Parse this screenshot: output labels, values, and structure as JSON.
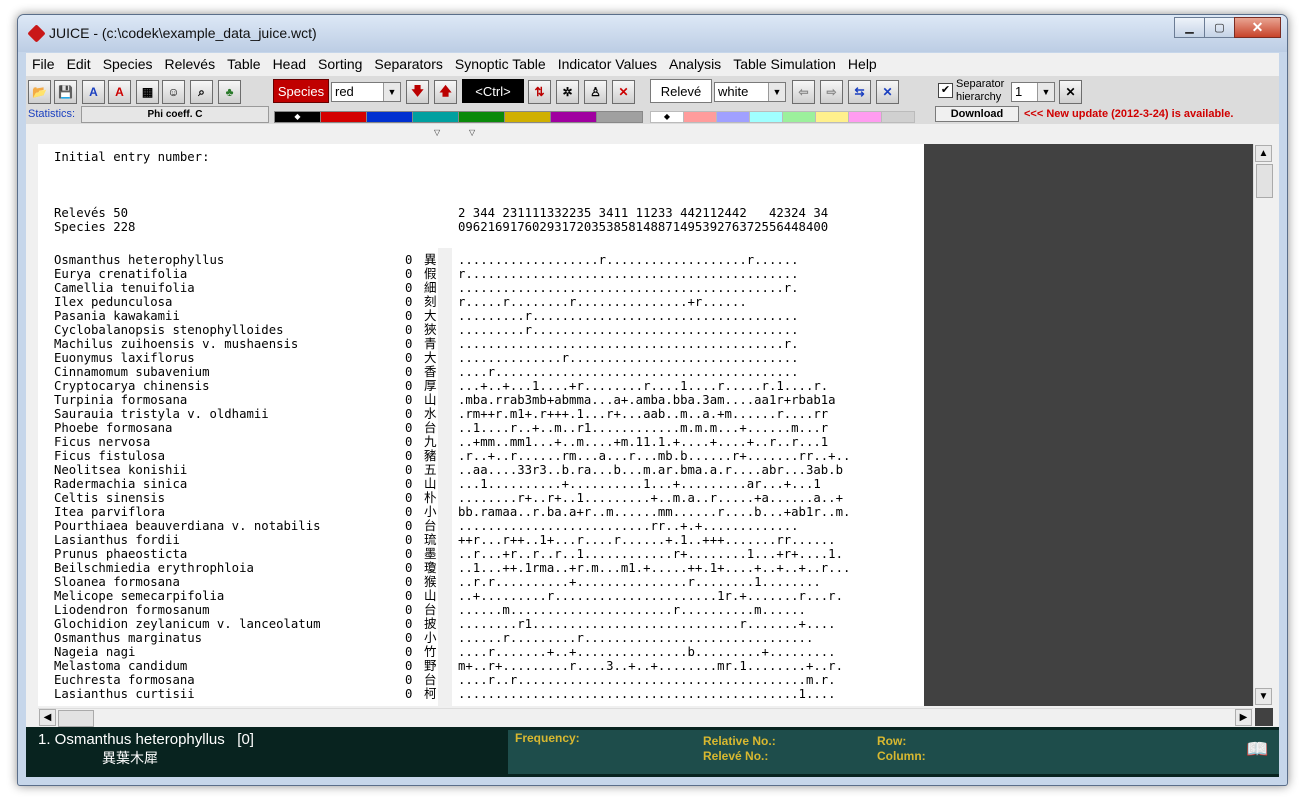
{
  "window": {
    "title": "JUICE - (c:\\codek\\example_data_juice.wct)"
  },
  "menu": [
    "File",
    "Edit",
    "Species",
    "Relevés",
    "Table",
    "Head",
    "Sorting",
    "Separators",
    "Synoptic Table",
    "Indicator Values",
    "Analysis",
    "Table Simulation",
    "Help"
  ],
  "toolbar": {
    "species_button": "Species",
    "species_color": "red",
    "ctrl_button": "<Ctrl>",
    "releve_button": "Relevé",
    "releve_color": "white",
    "separator_label_1": "Separator",
    "separator_label_2": "hierarchy",
    "separator_level": "1",
    "download_button": "Download",
    "update_notice": "<<< New update (2012-3-24) is available.",
    "statistics_label": "Statistics:",
    "statistics_value": "Phi coeff. C",
    "species_palette": [
      "#000000",
      "#d40000",
      "#0030d0",
      "#00a0a0",
      "#0a8a0a",
      "#d0b000",
      "#a000a0",
      "#a0a0a0"
    ],
    "releve_palette": [
      "#ffffff",
      "#ff9c9c",
      "#a0a0ff",
      "#a0ffff",
      "#9cf09c",
      "#fff08c",
      "#ff9cf0",
      "#d0d0d0"
    ]
  },
  "table": {
    "header_label": "Initial entry number:",
    "releves_line": "Relevés 50",
    "species_line": "Species 228",
    "releves_numbers": "2 344 231111332235 3411 11233 442112442   42324 34",
    "species_numbers": "09621691760293172035385814887149539276372556448400",
    "rows": [
      {
        "name": "Osmanthus heterophyllus",
        "n": "0",
        "k": "異",
        "pattern": "...................r...................r......"
      },
      {
        "name": "Eurya crenatifolia",
        "n": "0",
        "k": "假",
        "pattern": "r............................................."
      },
      {
        "name": "Camellia tenuifolia",
        "n": "0",
        "k": "細",
        "pattern": "............................................r."
      },
      {
        "name": "Ilex pedunculosa",
        "n": "0",
        "k": "刻",
        "pattern": "r.....r........r...............+r......"
      },
      {
        "name": "Pasania kawakamii",
        "n": "0",
        "k": "大",
        "pattern": ".........r...................................."
      },
      {
        "name": "Cyclobalanopsis stenophylloides",
        "n": "0",
        "k": "狹",
        "pattern": ".........r...................................."
      },
      {
        "name": "Machilus zuihoensis v. mushaensis",
        "n": "0",
        "k": "青",
        "pattern": "............................................r."
      },
      {
        "name": "Euonymus laxiflorus",
        "n": "0",
        "k": "大",
        "pattern": "..............r..............................."
      },
      {
        "name": "Cinnamomum subavenium",
        "n": "0",
        "k": "香",
        "pattern": "....r........................................."
      },
      {
        "name": "Cryptocarya chinensis",
        "n": "0",
        "k": "厚",
        "pattern": "...+..+...1....+r........r....1....r.....r.1....r."
      },
      {
        "name": "Turpinia formosana",
        "n": "0",
        "k": "山",
        "pattern": ".mba.rrab3mb+abmma...a+.amba.bba.3am....aa1r+rbab1a"
      },
      {
        "name": "Saurauia tristyla v. oldhamii",
        "n": "0",
        "k": "水",
        "pattern": ".rm++r.m1+.r+++.1...r+...aab..m..a.+m......r....rr"
      },
      {
        "name": "Phoebe formosana",
        "n": "0",
        "k": "台",
        "pattern": "..1....r..+..m..r1............m.m.m...+......m...r"
      },
      {
        "name": "Ficus nervosa",
        "n": "0",
        "k": "九",
        "pattern": "..+mm..mm1...+..m....+m.11.1.+....+....+..r..r...1"
      },
      {
        "name": "Ficus fistulosa",
        "n": "0",
        "k": "豬",
        "pattern": ".r..+..r......rm...a...r...mb.b......r+.......rr..+.."
      },
      {
        "name": "Neolitsea konishii",
        "n": "0",
        "k": "五",
        "pattern": "..aa....33r3..b.ra...b...m.ar.bma.a.r....abr...3ab.b"
      },
      {
        "name": "Radermachia sinica",
        "n": "0",
        "k": "山",
        "pattern": "...1..........+..........1...+.........ar...+...1"
      },
      {
        "name": "Celtis sinensis",
        "n": "0",
        "k": "朴",
        "pattern": "........r+..r+..1.........+..m.a..r.....+a......a..+"
      },
      {
        "name": "Itea parviflora",
        "n": "0",
        "k": "小",
        "pattern": "bb.ramaa..r.ba.a+r..m......mm......r....b...+ab1r..m."
      },
      {
        "name": "Pourthiaea beauverdiana v. notabilis",
        "n": "0",
        "k": "台",
        "pattern": "..........................rr..+.+............."
      },
      {
        "name": "Lasianthus fordii",
        "n": "0",
        "k": "琉",
        "pattern": "++r...r++..1+...r....r......+.1..+++.......rr......"
      },
      {
        "name": "Prunus phaeosticta",
        "n": "0",
        "k": "墨",
        "pattern": "..r...+r..r..r..1............r+........1...+r+....1."
      },
      {
        "name": "Beilschmiedia erythrophloia",
        "n": "0",
        "k": "瓊",
        "pattern": "..1...++.1rma..+r.m...m1.+.....++.1+....+..+..+..r..."
      },
      {
        "name": "Sloanea formosana",
        "n": "0",
        "k": "猴",
        "pattern": "..r.r..........+...............r........1........"
      },
      {
        "name": "Melicope semecarpifolia",
        "n": "0",
        "k": "山",
        "pattern": "..+.........r......................1r.+.......r...r."
      },
      {
        "name": "Liodendron formosanum",
        "n": "0",
        "k": "台",
        "pattern": "......m......................r..........m......"
      },
      {
        "name": "Glochidion zeylanicum v. lanceolatum",
        "n": "0",
        "k": "披",
        "pattern": "........r1............................r.......+...."
      },
      {
        "name": "Osmanthus marginatus",
        "n": "0",
        "k": "小",
        "pattern": "......r.........r..............................."
      },
      {
        "name": "Nageia nagi",
        "n": "0",
        "k": "竹",
        "pattern": "....r.......+..+...............b.........+........."
      },
      {
        "name": "Melastoma candidum",
        "n": "0",
        "k": "野",
        "pattern": "m+..r+.........r....3..+..+........mr.1........+..r."
      },
      {
        "name": "Euchresta formosana",
        "n": "0",
        "k": "台",
        "pattern": "....r..r.......................................m.r."
      },
      {
        "name": "Lasianthus curtisii",
        "n": "0",
        "k": "柯",
        "pattern": "..............................................1...."
      }
    ]
  },
  "status": {
    "selected_species": "1. Osmanthus heterophyllus   [0]",
    "selected_species_local": "異葉木犀",
    "frequency_label": "Frequency:",
    "relative_no_label": "Relative No.:",
    "releve_no_label": "Relevé No.:",
    "row_label": "Row:",
    "column_label": "Column:"
  }
}
